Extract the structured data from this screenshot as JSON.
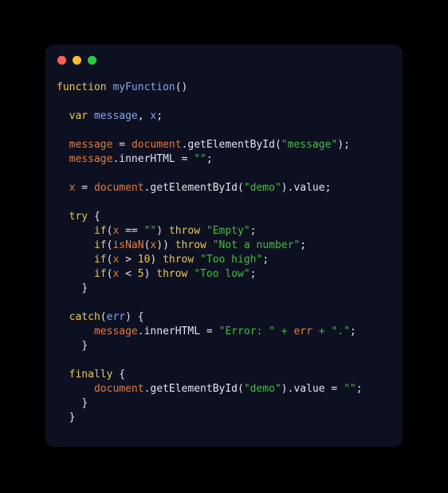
{
  "window": {
    "dots": [
      {
        "name": "close-dot",
        "color": "#ff5f56"
      },
      {
        "name": "minimize-dot",
        "color": "#ffbd2e"
      },
      {
        "name": "maximize-dot",
        "color": "#27c93f"
      }
    ],
    "background": "#0d1021",
    "page_background": "#000000"
  },
  "code": {
    "language": "javascript",
    "plain_text": "function myFunction()\n\n  var message, x;\n\n  message = document.getElementById(\"message\");\n  message.innerHTML = \"\";\n\n  x = document.getElementById(\"demo\").value;\n\n  try {\n      if(x == \"\") throw \"Empty\";\n      if(isNaN(x)) throw \"Not a number\";\n      if(x > 10) throw \"Too high\";\n      if(x < 5) throw \"Too low\";\n    }\n\n  catch(err) {\n      message.innerHTML = \"Error: \" + err + \".\";\n    }\n\n  finally {\n      document.getElementById(\"demo\").value = \"\";\n    }\n  }",
    "lines": [
      {
        "indent": 0,
        "tokens": [
          {
            "t": "function",
            "c": "kw"
          },
          {
            "t": " ",
            "c": "plain"
          },
          {
            "t": "myFunction",
            "c": "fn"
          },
          {
            "t": "()",
            "c": "punct"
          }
        ]
      },
      {
        "indent": 0,
        "tokens": []
      },
      {
        "indent": 2,
        "tokens": [
          {
            "t": "var",
            "c": "kw"
          },
          {
            "t": " ",
            "c": "plain"
          },
          {
            "t": "message",
            "c": "param"
          },
          {
            "t": ", ",
            "c": "punct"
          },
          {
            "t": "x",
            "c": "param"
          },
          {
            "t": ";",
            "c": "punct"
          }
        ]
      },
      {
        "indent": 0,
        "tokens": []
      },
      {
        "indent": 2,
        "tokens": [
          {
            "t": "message",
            "c": "var"
          },
          {
            "t": " = ",
            "c": "op"
          },
          {
            "t": "document",
            "c": "var"
          },
          {
            "t": ".",
            "c": "punct"
          },
          {
            "t": "getElementById",
            "c": "prop"
          },
          {
            "t": "(",
            "c": "punct"
          },
          {
            "t": "\"message\"",
            "c": "str"
          },
          {
            "t": ");",
            "c": "punct"
          }
        ]
      },
      {
        "indent": 2,
        "tokens": [
          {
            "t": "message",
            "c": "var"
          },
          {
            "t": ".",
            "c": "punct"
          },
          {
            "t": "innerHTML",
            "c": "prop"
          },
          {
            "t": " = ",
            "c": "op"
          },
          {
            "t": "\"\"",
            "c": "str"
          },
          {
            "t": ";",
            "c": "punct"
          }
        ]
      },
      {
        "indent": 0,
        "tokens": []
      },
      {
        "indent": 2,
        "tokens": [
          {
            "t": "x",
            "c": "var"
          },
          {
            "t": " = ",
            "c": "op"
          },
          {
            "t": "document",
            "c": "var"
          },
          {
            "t": ".",
            "c": "punct"
          },
          {
            "t": "getElementById",
            "c": "prop"
          },
          {
            "t": "(",
            "c": "punct"
          },
          {
            "t": "\"demo\"",
            "c": "str"
          },
          {
            "t": ").",
            "c": "punct"
          },
          {
            "t": "value",
            "c": "prop"
          },
          {
            "t": ";",
            "c": "punct"
          }
        ]
      },
      {
        "indent": 0,
        "tokens": []
      },
      {
        "indent": 2,
        "tokens": [
          {
            "t": "try",
            "c": "kw"
          },
          {
            "t": " {",
            "c": "punct"
          }
        ]
      },
      {
        "indent": 6,
        "tokens": [
          {
            "t": "if",
            "c": "kw"
          },
          {
            "t": "(",
            "c": "punct"
          },
          {
            "t": "x",
            "c": "var"
          },
          {
            "t": " == ",
            "c": "op"
          },
          {
            "t": "\"\"",
            "c": "str"
          },
          {
            "t": ") ",
            "c": "punct"
          },
          {
            "t": "throw",
            "c": "kw"
          },
          {
            "t": " ",
            "c": "plain"
          },
          {
            "t": "\"Empty\"",
            "c": "str"
          },
          {
            "t": ";",
            "c": "punct"
          }
        ]
      },
      {
        "indent": 6,
        "tokens": [
          {
            "t": "if",
            "c": "kw"
          },
          {
            "t": "(",
            "c": "punct"
          },
          {
            "t": "isNaN",
            "c": "var"
          },
          {
            "t": "(",
            "c": "punct"
          },
          {
            "t": "x",
            "c": "var"
          },
          {
            "t": ")) ",
            "c": "punct"
          },
          {
            "t": "throw",
            "c": "kw"
          },
          {
            "t": " ",
            "c": "plain"
          },
          {
            "t": "\"Not a number\"",
            "c": "str"
          },
          {
            "t": ";",
            "c": "punct"
          }
        ]
      },
      {
        "indent": 6,
        "tokens": [
          {
            "t": "if",
            "c": "kw"
          },
          {
            "t": "(",
            "c": "punct"
          },
          {
            "t": "x",
            "c": "var"
          },
          {
            "t": " > ",
            "c": "op"
          },
          {
            "t": "10",
            "c": "num"
          },
          {
            "t": ") ",
            "c": "punct"
          },
          {
            "t": "throw",
            "c": "kw"
          },
          {
            "t": " ",
            "c": "plain"
          },
          {
            "t": "\"Too high\"",
            "c": "str"
          },
          {
            "t": ";",
            "c": "punct"
          }
        ]
      },
      {
        "indent": 6,
        "tokens": [
          {
            "t": "if",
            "c": "kw"
          },
          {
            "t": "(",
            "c": "punct"
          },
          {
            "t": "x",
            "c": "var"
          },
          {
            "t": " < ",
            "c": "op"
          },
          {
            "t": "5",
            "c": "num"
          },
          {
            "t": ") ",
            "c": "punct"
          },
          {
            "t": "throw",
            "c": "kw"
          },
          {
            "t": " ",
            "c": "plain"
          },
          {
            "t": "\"Too low\"",
            "c": "str"
          },
          {
            "t": ";",
            "c": "punct"
          }
        ]
      },
      {
        "indent": 4,
        "tokens": [
          {
            "t": "}",
            "c": "punct"
          }
        ]
      },
      {
        "indent": 0,
        "tokens": []
      },
      {
        "indent": 2,
        "tokens": [
          {
            "t": "catch",
            "c": "kw"
          },
          {
            "t": "(",
            "c": "punct"
          },
          {
            "t": "err",
            "c": "param"
          },
          {
            "t": ") {",
            "c": "punct"
          }
        ]
      },
      {
        "indent": 6,
        "tokens": [
          {
            "t": "message",
            "c": "var"
          },
          {
            "t": ".",
            "c": "punct"
          },
          {
            "t": "innerHTML",
            "c": "prop"
          },
          {
            "t": " = ",
            "c": "op"
          },
          {
            "t": "\"Error: \"",
            "c": "str"
          },
          {
            "t": " + ",
            "c": "opstr"
          },
          {
            "t": "err",
            "c": "var"
          },
          {
            "t": " + ",
            "c": "opstr"
          },
          {
            "t": "\".\"",
            "c": "str"
          },
          {
            "t": ";",
            "c": "punct"
          }
        ]
      },
      {
        "indent": 4,
        "tokens": [
          {
            "t": "}",
            "c": "punct"
          }
        ]
      },
      {
        "indent": 0,
        "tokens": []
      },
      {
        "indent": 2,
        "tokens": [
          {
            "t": "finally",
            "c": "kw"
          },
          {
            "t": " {",
            "c": "punct"
          }
        ]
      },
      {
        "indent": 6,
        "tokens": [
          {
            "t": "document",
            "c": "var"
          },
          {
            "t": ".",
            "c": "punct"
          },
          {
            "t": "getElementById",
            "c": "prop"
          },
          {
            "t": "(",
            "c": "punct"
          },
          {
            "t": "\"demo\"",
            "c": "str"
          },
          {
            "t": ").",
            "c": "punct"
          },
          {
            "t": "value",
            "c": "prop"
          },
          {
            "t": " = ",
            "c": "op"
          },
          {
            "t": "\"\"",
            "c": "str"
          },
          {
            "t": ";",
            "c": "punct"
          }
        ]
      },
      {
        "indent": 4,
        "tokens": [
          {
            "t": "}",
            "c": "punct"
          }
        ]
      },
      {
        "indent": 2,
        "tokens": [
          {
            "t": "}",
            "c": "punct"
          }
        ]
      }
    ]
  }
}
